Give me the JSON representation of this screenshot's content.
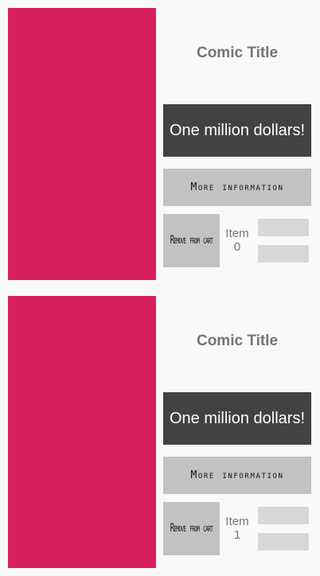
{
  "colors": {
    "cover": "#d81f5d",
    "price_button_bg": "#424242",
    "secondary_button_bg": "#c2c2c2",
    "background": "#f9f9f9"
  },
  "comics": [
    {
      "title": "Comic Title",
      "price_label": "One million dollars!",
      "more_info_label": "More information",
      "remove_label": "Remove from cart",
      "item_word": "Item",
      "item_number": "0"
    },
    {
      "title": "Comic Title",
      "price_label": "One million dollars!",
      "more_info_label": "More information",
      "remove_label": "Remove from cart",
      "item_word": "Item",
      "item_number": "1"
    }
  ]
}
